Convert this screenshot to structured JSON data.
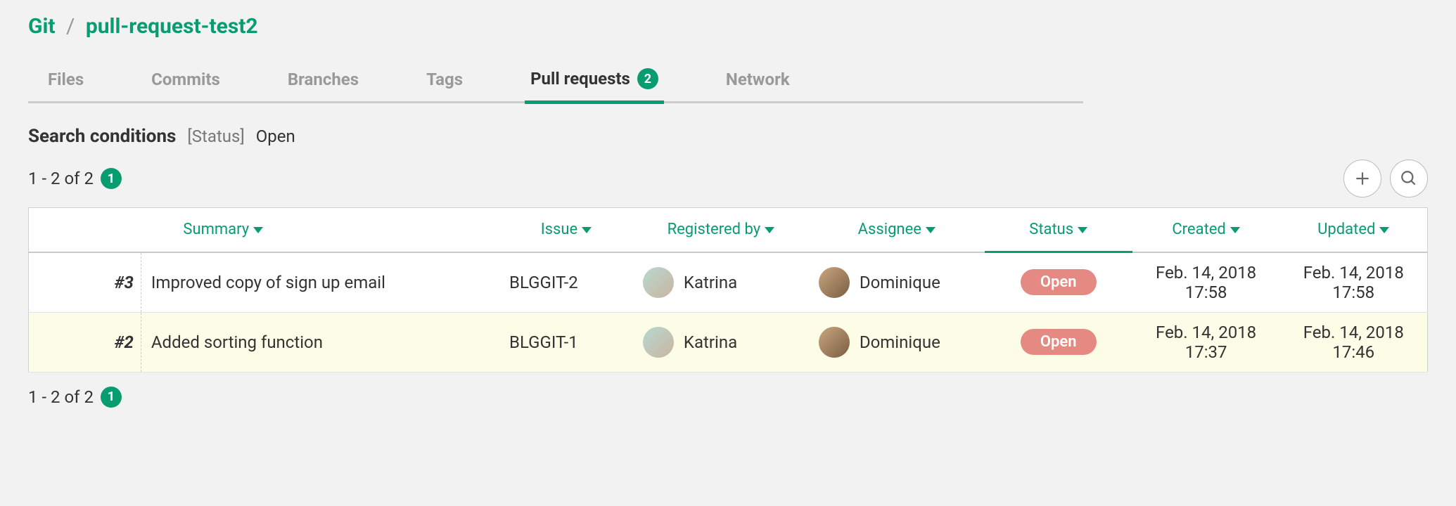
{
  "breadcrumb": {
    "root": "Git",
    "repo": "pull-request-test2"
  },
  "tabs": [
    {
      "label": "Files",
      "active": false
    },
    {
      "label": "Commits",
      "active": false
    },
    {
      "label": "Branches",
      "active": false
    },
    {
      "label": "Tags",
      "active": false
    },
    {
      "label": "Pull requests",
      "active": true,
      "badge": "2"
    },
    {
      "label": "Network",
      "active": false
    }
  ],
  "search_conditions": {
    "title": "Search conditions",
    "status_label": "[Status]",
    "status_value": "Open"
  },
  "pagination": {
    "range_text": "1 - 2 of 2",
    "page_badge": "1"
  },
  "columns": {
    "summary": "Summary",
    "issue": "Issue",
    "registered_by": "Registered by",
    "assignee": "Assignee",
    "status": "Status",
    "created": "Created",
    "updated": "Updated"
  },
  "rows": [
    {
      "id": "#3",
      "summary": "Improved copy of sign up email",
      "issue": "BLGGIT-2",
      "registered_by": "Katrina",
      "assignee": "Dominique",
      "status": "Open",
      "created": "Feb. 14, 2018 17:58",
      "updated": "Feb. 14, 2018 17:58"
    },
    {
      "id": "#2",
      "summary": "Added sorting function",
      "issue": "BLGGIT-1",
      "registered_by": "Katrina",
      "assignee": "Dominique",
      "status": "Open",
      "created": "Feb. 14, 2018 17:37",
      "updated": "Feb. 14, 2018 17:46"
    }
  ],
  "colors": {
    "accent": "#089c71",
    "status_open": "#e58a82"
  }
}
